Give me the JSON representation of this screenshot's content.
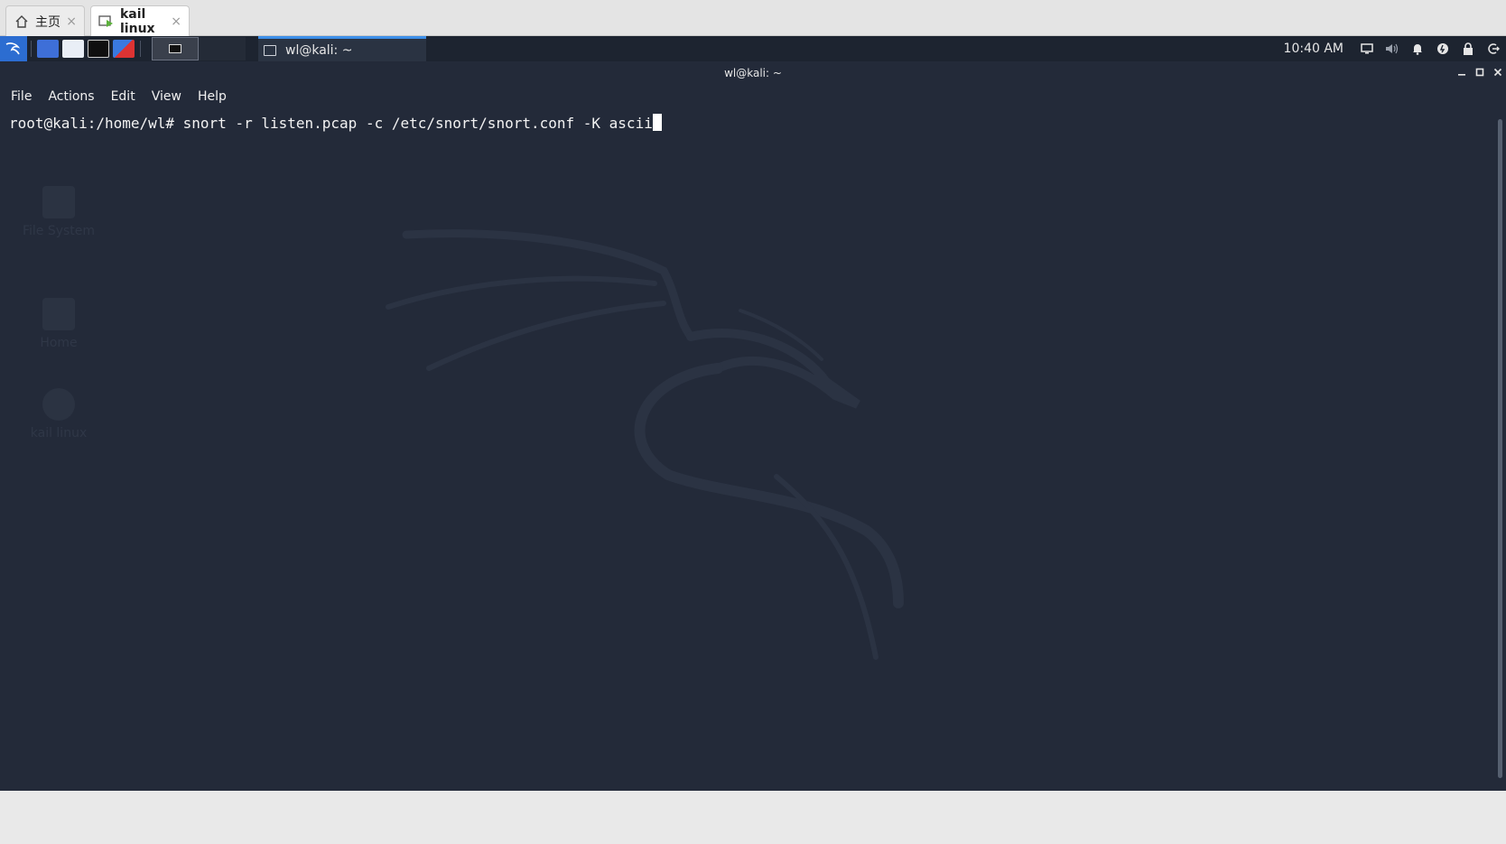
{
  "host": {
    "tabs": [
      {
        "label": "主页",
        "icon": "home-icon",
        "active": false
      },
      {
        "label": "kail linux",
        "icon": "vm-icon",
        "active": true
      }
    ],
    "close_glyph": "×"
  },
  "panel": {
    "task_title": "wl@kali: ~",
    "clock": "10:40 AM",
    "tray_icons": [
      "display-icon",
      "volume-icon",
      "bell-icon",
      "power-icon",
      "lock-icon",
      "logout-icon"
    ]
  },
  "terminal": {
    "window_title": "wl@kali: ~",
    "menu": [
      "File",
      "Actions",
      "Edit",
      "View",
      "Help"
    ],
    "prompt": "root@kali:/home/wl# ",
    "command": "snort -r listen.pcap -c /etc/snort/snort.conf -K ascii"
  },
  "desktop": {
    "icons": [
      "File System",
      "Home",
      "kail linux"
    ]
  },
  "colors": {
    "terminal_bg": "#232a39",
    "panel_bg": "#1d2430",
    "accent": "#3d8fe8"
  }
}
